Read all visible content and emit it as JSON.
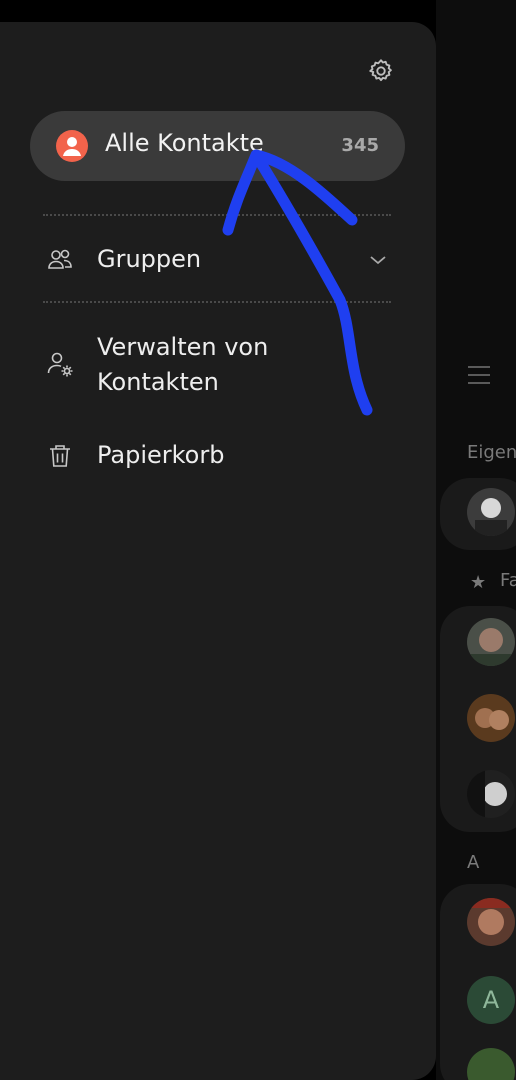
{
  "drawer": {
    "settings_icon": "gear-icon",
    "all_contacts": {
      "label": "Alle Kontakte",
      "count": "345",
      "icon": "person-icon"
    },
    "items": [
      {
        "label": "Gruppen",
        "icon": "group-icon",
        "expandable": true
      },
      {
        "label": "Verwalten von Kontakten",
        "icon": "person-settings-icon"
      },
      {
        "label": "Papierkorb",
        "icon": "trash-icon"
      }
    ]
  },
  "background": {
    "section_own": "Eigen",
    "section_favorites": "Fa",
    "section_letter": "A",
    "avatar_letter": "A"
  },
  "colors": {
    "accent": "#f2634b",
    "drawer_bg": "#1d1d1d",
    "selected_bg": "#3a3a3a",
    "annotation_stroke": "#1f3ff0"
  }
}
